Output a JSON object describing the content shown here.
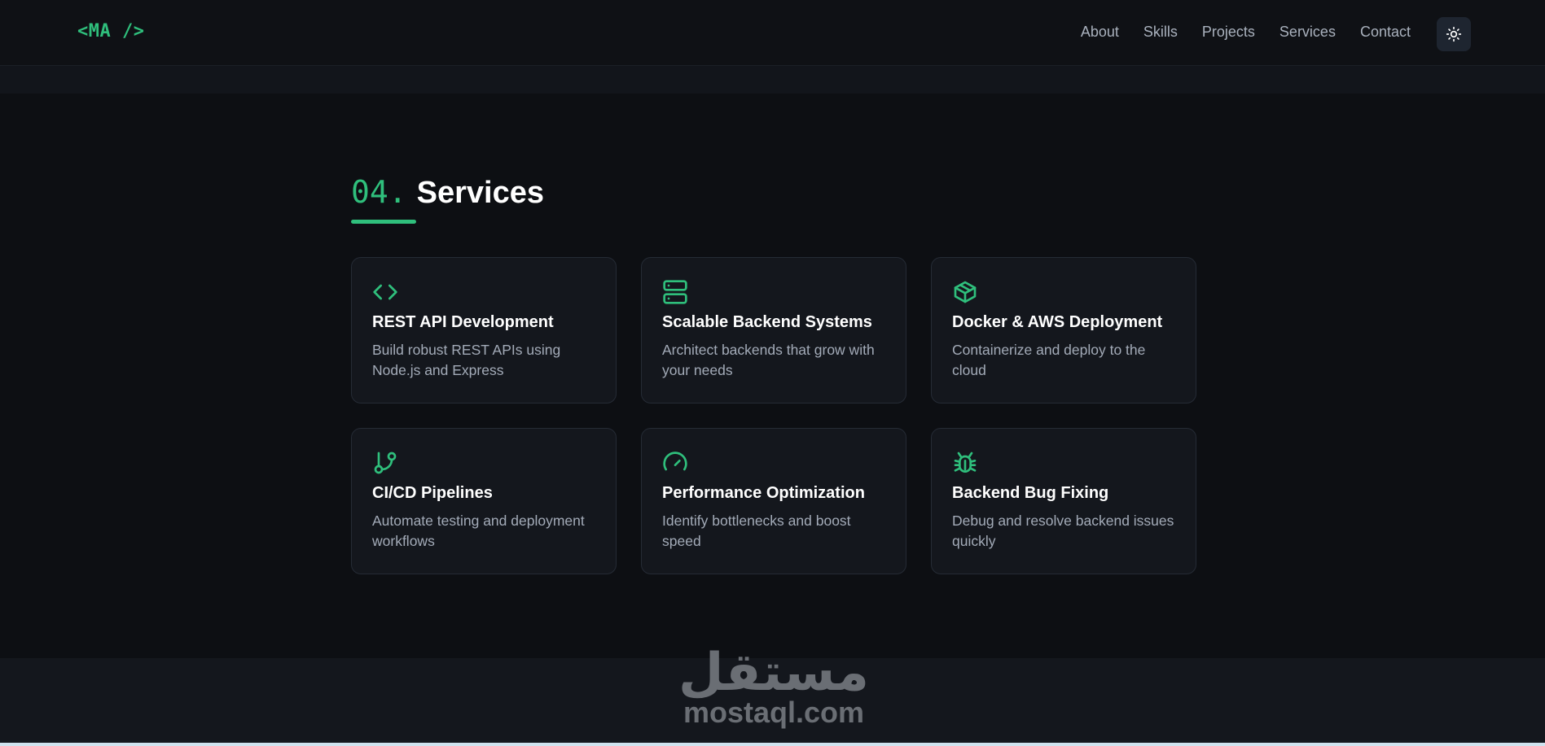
{
  "header": {
    "logo": "<MA />",
    "nav": [
      "About",
      "Skills",
      "Projects",
      "Services",
      "Contact"
    ]
  },
  "section": {
    "number": "04.",
    "title": "Services"
  },
  "services": [
    {
      "icon": "code-icon",
      "title": "REST API Development",
      "desc": "Build robust REST APIs using Node.js and Express"
    },
    {
      "icon": "server-icon",
      "title": "Scalable Backend Systems",
      "desc": "Architect backends that grow with your needs"
    },
    {
      "icon": "box-icon",
      "title": "Docker & AWS Deployment",
      "desc": "Containerize and deploy to the cloud"
    },
    {
      "icon": "git-branch-icon",
      "title": "CI/CD Pipelines",
      "desc": "Automate testing and deployment workflows"
    },
    {
      "icon": "gauge-icon",
      "title": "Performance Optimization",
      "desc": "Identify bottlenecks and boost speed"
    },
    {
      "icon": "bug-icon",
      "title": "Backend Bug Fixing",
      "desc": "Debug and resolve backend issues quickly"
    }
  ],
  "watermark": {
    "arabic": "مستقل",
    "latin": "mostaql.com"
  },
  "colors": {
    "accent": "#2fbf7c",
    "background": "#0d0f13",
    "card": "#14171d"
  }
}
